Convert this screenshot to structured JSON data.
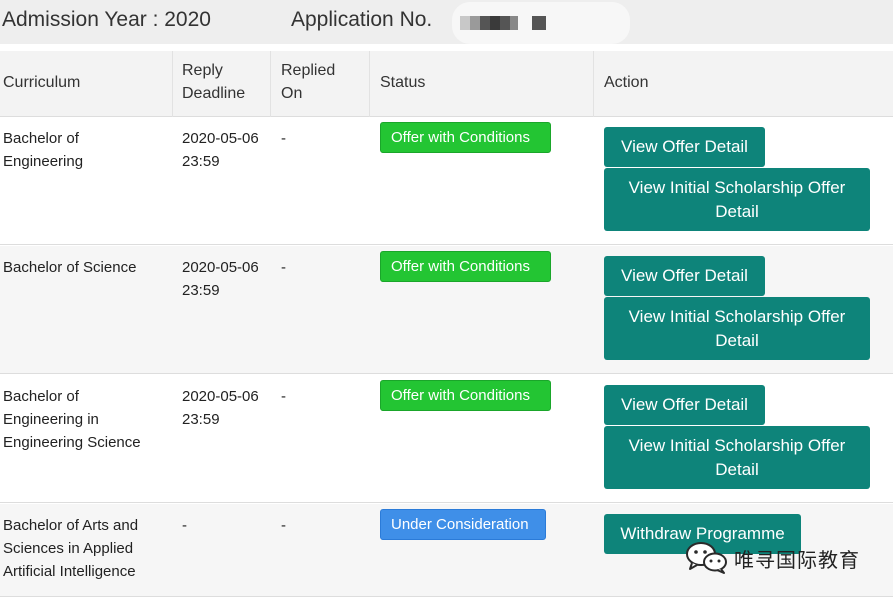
{
  "header": {
    "admission_year": "Admission Year : 2020",
    "application_no": "Application No."
  },
  "columns": {
    "curriculum": "Curriculum",
    "reply_deadline": "Reply Deadline",
    "replied_on": "Replied On",
    "status": "Status",
    "action": "Action"
  },
  "rows": [
    {
      "curriculum": "Bachelor of Engineering",
      "reply_deadline": "2020-05-06 23:59",
      "replied_on": "-",
      "status": "Offer with Conditions",
      "status_color": "#23c533",
      "actions": [
        "View Offer Detail",
        "View Initial Scholarship Offer Detail"
      ]
    },
    {
      "curriculum": "Bachelor of Science",
      "reply_deadline": "2020-05-06 23:59",
      "replied_on": "-",
      "status": "Offer with Conditions",
      "status_color": "#23c533",
      "actions": [
        "View Offer Detail",
        "View Initial Scholarship Offer Detail"
      ]
    },
    {
      "curriculum": "Bachelor of Engineering in Engineering Science",
      "reply_deadline": "2020-05-06 23:59",
      "replied_on": "-",
      "status": "Offer with Conditions",
      "status_color": "#23c533",
      "actions": [
        "View Offer Detail",
        "View Initial Scholarship Offer Detail"
      ]
    },
    {
      "curriculum": "Bachelor of Arts and Sciences in Applied Artificial Intelligence",
      "reply_deadline": "-",
      "replied_on": "-",
      "status": "Under Consideration",
      "status_color": "#3f8fe8",
      "actions": [
        "Withdraw Programme"
      ]
    }
  ],
  "colors": {
    "action_button": "#0e847a",
    "header_bg": "#eeeeee"
  },
  "watermark": {
    "icon": "wechat-logo-icon",
    "text": "唯寻国际教育"
  }
}
